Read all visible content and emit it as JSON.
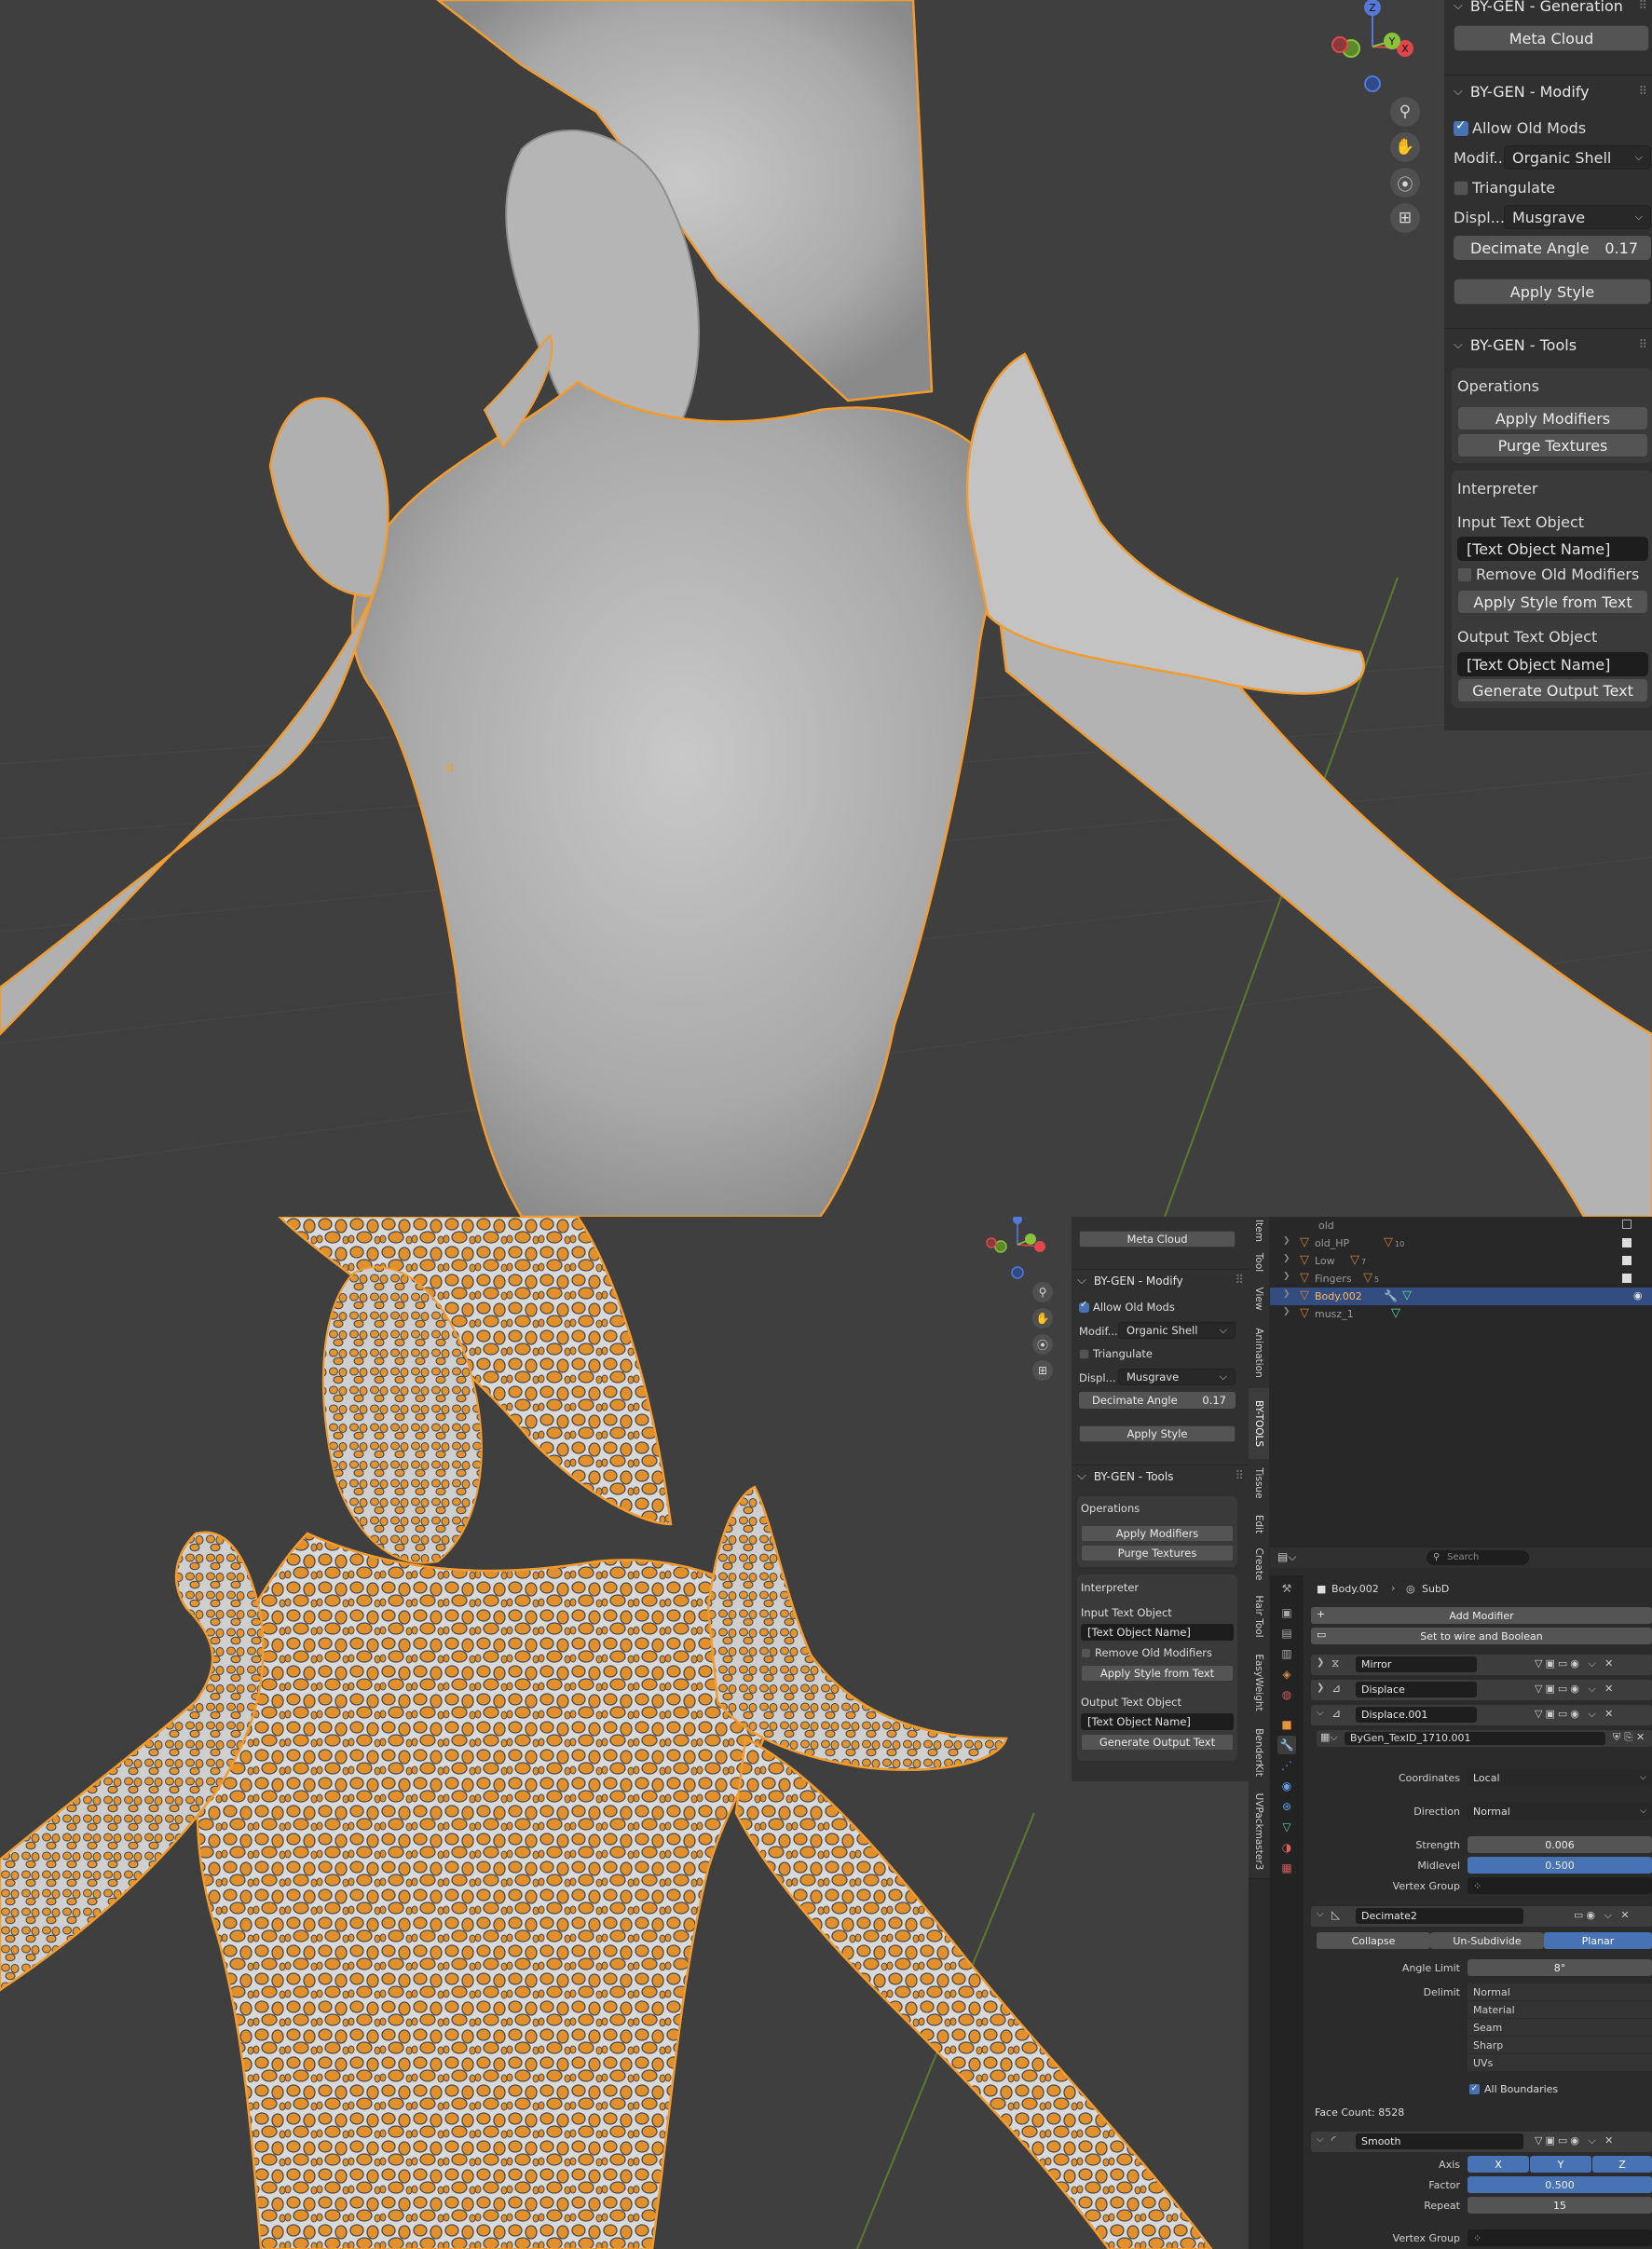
{
  "top_panel": {
    "generation": {
      "title": "BY-GEN - Generation",
      "meta_cloud": "Meta Cloud"
    },
    "modify": {
      "title": "BY-GEN - Modify",
      "allow_old_mods": "Allow Old Mods",
      "modif_label": "Modif...",
      "modif_value": "Organic Shell",
      "triangulate": "Triangulate",
      "displ_label": "Displ...",
      "displ_value": "Musgrave",
      "decimate_label": "Decimate Angle",
      "decimate_value": "0.17",
      "apply_style": "Apply Style"
    },
    "tools": {
      "title": "BY-GEN - Tools",
      "operations": "Operations",
      "apply_modifiers": "Apply Modifiers",
      "purge_textures": "Purge Textures",
      "interpreter": "Interpreter",
      "input_text_object": "Input Text Object",
      "text_object_placeholder": "[Text Object Name]",
      "remove_old_modifiers": "Remove Old Modifiers",
      "apply_style_from_text": "Apply Style from Text",
      "output_text_object": "Output Text Object",
      "generate_output_text": "Generate Output Text"
    }
  },
  "gizmo": {
    "x": "X",
    "y": "Y",
    "z": "Z"
  },
  "bottom_panel": {
    "meta_cloud": "Meta Cloud",
    "modify_title": "BY-GEN - Modify",
    "allow_old_mods": "Allow Old Mods",
    "modif_label": "Modif...",
    "modif_value": "Organic Shell",
    "triangulate": "Triangulate",
    "displ_label": "Displ...",
    "displ_value": "Musgrave",
    "decimate_label": "Decimate Angle",
    "decimate_value": "0.17",
    "apply_style": "Apply Style",
    "tools_title": "BY-GEN - Tools",
    "operations": "Operations",
    "apply_modifiers": "Apply Modifiers",
    "purge_textures": "Purge Textures",
    "interpreter": "Interpreter",
    "input_text_object": "Input Text Object",
    "text_object_placeholder": "[Text Object Name]",
    "remove_old_modifiers": "Remove Old Modifiers",
    "apply_style_from_text": "Apply Style from Text",
    "output_text_object": "Output Text Object",
    "generate_output_text": "Generate Output Text"
  },
  "side_tabs": [
    "Item",
    "Tool",
    "View",
    "Animation",
    "BY-TOOLS",
    "Tissue",
    "Edit",
    "Create",
    "Hair Tool",
    "EasyWeight",
    "BenderKit",
    "UVPackmaster3"
  ],
  "outliner": {
    "rows": [
      {
        "name": "old",
        "count": ""
      },
      {
        "name": "old_HP",
        "count": "10"
      },
      {
        "name": "Low",
        "count": "7"
      },
      {
        "name": "Fingers",
        "count": "5"
      },
      {
        "name": "Body.002",
        "count": ""
      },
      {
        "name": "musz_1",
        "count": ""
      }
    ]
  },
  "properties": {
    "search_placeholder": "Search",
    "breadcrumb_object": "Body.002",
    "breadcrumb_modifier": "SubD",
    "add_modifier": "Add Modifier",
    "set_wire": "Set to wire and Boolean",
    "modifiers": {
      "mirror": "Mirror",
      "displace": "Displace",
      "displace001": "Displace.001",
      "texture": "ByGen_TexID_1710.001",
      "coordinates_label": "Coordinates",
      "coordinates_value": "Local",
      "direction_label": "Direction",
      "direction_value": "Normal",
      "strength_label": "Strength",
      "strength_value": "0.006",
      "midlevel_label": "Midlevel",
      "midlevel_value": "0.500",
      "vertex_group_label": "Vertex Group",
      "decimate": "Decimate2",
      "collapse": "Collapse",
      "unsubdivide": "Un-Subdivide",
      "planar": "Planar",
      "angle_limit_label": "Angle Limit",
      "angle_limit_value": "8°",
      "delimit_label": "Delimit",
      "delimit_options": [
        "Normal",
        "Material",
        "Seam",
        "Sharp",
        "UVs"
      ],
      "all_boundaries": "All Boundaries",
      "face_count": "Face Count: 8528",
      "smooth": "Smooth",
      "axis_label": "Axis",
      "axis_x": "X",
      "axis_y": "Y",
      "axis_z": "Z",
      "factor_label": "Factor",
      "factor_value": "0.500",
      "repeat_label": "Repeat",
      "repeat_value": "15",
      "vertex_group_label2": "Vertex Group"
    }
  },
  "colors": {
    "selection_orange": "#f29b2e",
    "accent_blue": "#4772b3",
    "panel": "#303030",
    "viewport": "#3f3f3f"
  }
}
